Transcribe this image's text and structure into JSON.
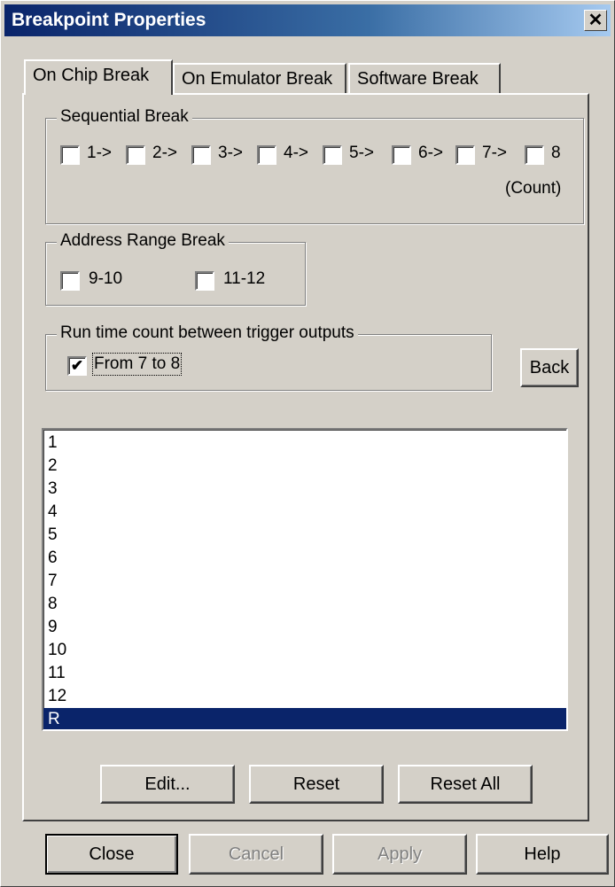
{
  "window": {
    "title": "Breakpoint Properties",
    "close_glyph": "✕"
  },
  "tabs": [
    {
      "label": "On Chip Break",
      "active": true
    },
    {
      "label": "On Emulator Break",
      "active": false
    },
    {
      "label": "Software Break",
      "active": false
    }
  ],
  "sequential": {
    "legend": "Sequential Break",
    "items": [
      {
        "label": "1->",
        "checked": false
      },
      {
        "label": "2->",
        "checked": false
      },
      {
        "label": "3->",
        "checked": false
      },
      {
        "label": "4->",
        "checked": false
      },
      {
        "label": "5->",
        "checked": false
      },
      {
        "label": "6->",
        "checked": false
      },
      {
        "label": "7->",
        "checked": false
      },
      {
        "label": "8",
        "checked": false
      }
    ],
    "count_label": "(Count)"
  },
  "address_range": {
    "legend": "Address Range Break",
    "items": [
      {
        "label": "9-10",
        "checked": false
      },
      {
        "label": "11-12",
        "checked": false
      }
    ]
  },
  "runtime": {
    "legend": "Run time count between trigger outputs",
    "checkbox_label": "From 7 to 8",
    "checked": true
  },
  "back_button": "Back",
  "list_items": [
    "1",
    "2",
    "3",
    "4",
    "5",
    "6",
    "7",
    "8",
    "9",
    "10",
    "11",
    "12",
    "R"
  ],
  "selected_item": "R",
  "panel_buttons": {
    "edit": "Edit...",
    "reset": "Reset",
    "reset_all": "Reset All"
  },
  "footer_buttons": {
    "close": "Close",
    "cancel": "Cancel",
    "apply": "Apply",
    "help": "Help"
  },
  "colors": {
    "selection": "#0a246a",
    "face": "#d4d0c8"
  }
}
